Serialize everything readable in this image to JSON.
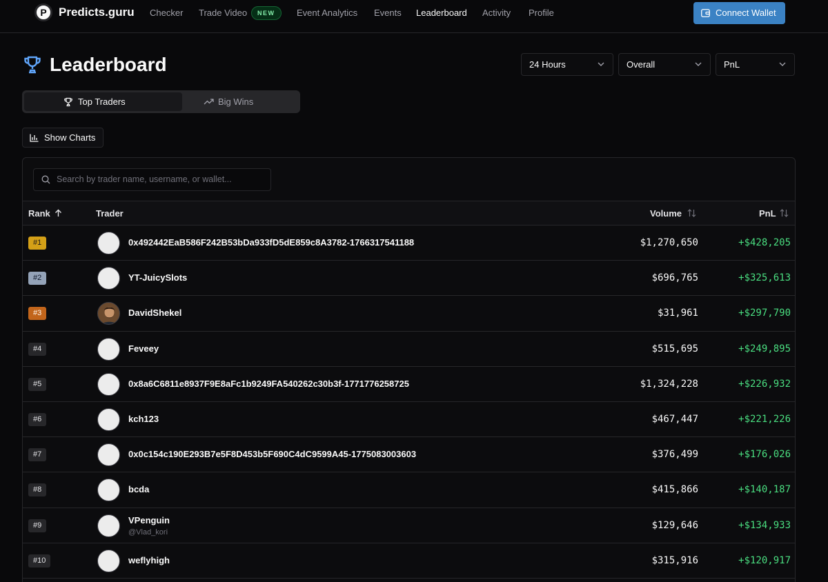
{
  "nav": {
    "logo_letter": "P",
    "brand": "Predicts.guru",
    "links": [
      "Checker",
      "Trade Video",
      "Event Analytics",
      "Events",
      "Leaderboard",
      "Activity",
      "Profile"
    ],
    "new_badge": "NEW",
    "connect_wallet": "Connect Wallet"
  },
  "header": {
    "title": "Leaderboard",
    "filters": [
      "24 Hours",
      "Overall",
      "PnL"
    ]
  },
  "tabs": [
    "Top Traders",
    "Big Wins"
  ],
  "show_charts": "Show Charts",
  "search": {
    "placeholder": "Search by trader name, username, or wallet..."
  },
  "table": {
    "columns": [
      "Rank",
      "Trader",
      "Volume",
      "PnL"
    ],
    "rows": [
      {
        "rank": "#1",
        "name": "0x492442EaB586F242B53bDa933fD5dE859c8A3782-1766317541188",
        "sub": "",
        "volume": "$1,270,650",
        "pnl": "+$428,205"
      },
      {
        "rank": "#2",
        "name": "YT-JuicySlots",
        "sub": "",
        "volume": "$696,765",
        "pnl": "+$325,613"
      },
      {
        "rank": "#3",
        "name": "DavidShekel",
        "sub": "",
        "volume": "$31,961",
        "pnl": "+$297,790"
      },
      {
        "rank": "#4",
        "name": "Feveey",
        "sub": "",
        "volume": "$515,695",
        "pnl": "+$249,895"
      },
      {
        "rank": "#5",
        "name": "0x8a6C6811e8937F9E8aFc1b9249FA540262c30b3f-1771776258725",
        "sub": "",
        "volume": "$1,324,228",
        "pnl": "+$226,932"
      },
      {
        "rank": "#6",
        "name": "kch123",
        "sub": "",
        "volume": "$467,447",
        "pnl": "+$221,226"
      },
      {
        "rank": "#7",
        "name": "0x0c154c190E293B7e5F8D453b5F690C4dC9599A45-1775083003603",
        "sub": "",
        "volume": "$376,499",
        "pnl": "+$176,026"
      },
      {
        "rank": "#8",
        "name": "bcda",
        "sub": "",
        "volume": "$415,866",
        "pnl": "+$140,187"
      },
      {
        "rank": "#9",
        "name": "VPenguin",
        "sub": "@Vlad_kori",
        "volume": "$129,646",
        "pnl": "+$134,933"
      },
      {
        "rank": "#10",
        "name": "weflyhigh",
        "sub": "",
        "volume": "$315,916",
        "pnl": "+$120,917"
      }
    ]
  },
  "colors": {
    "background": "#09090b",
    "accent_button": "#3b82c4",
    "pnl_positive": "#4ade80",
    "rank_gold": "#d4a017",
    "rank_silver": "#94a3b8",
    "rank_bronze": "#c2651b"
  }
}
